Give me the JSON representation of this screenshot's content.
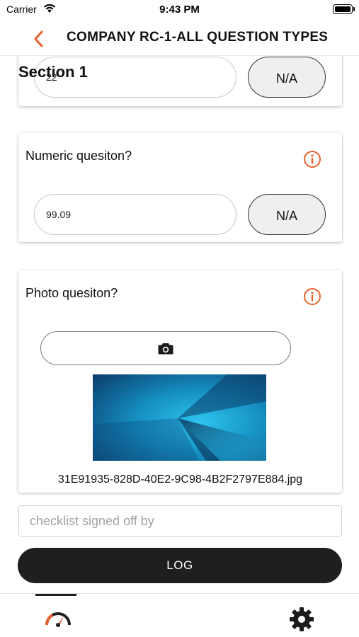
{
  "status_bar": {
    "carrier": "Carrier",
    "time": "9:43 PM"
  },
  "header": {
    "title": "COMPANY RC-1-ALL QUESTION TYPES"
  },
  "section": {
    "title": "Section 1"
  },
  "questions": [
    {
      "type": "text",
      "value": "22",
      "na_label": "N/A"
    },
    {
      "type": "numeric",
      "label": "Numeric quesiton?",
      "value": "99.09",
      "na_label": "N/A",
      "info_icon": "info-icon"
    },
    {
      "type": "photo",
      "label": "Photo quesiton?",
      "info_icon": "info-icon",
      "camera_icon": "camera-icon",
      "filename": "31E91935-828D-40E2-9C98-4B2F2797E884.jpg"
    }
  ],
  "signoff": {
    "placeholder": "checklist signed off by",
    "value": ""
  },
  "log_button": {
    "label": "LOG"
  },
  "tab_bar": {
    "tabs": [
      {
        "icon": "dashboard-gauge-icon",
        "active": true
      },
      {
        "icon": "gear-icon",
        "active": false
      }
    ]
  },
  "colors": {
    "accent": "#e8622c",
    "dark_button": "#1f1f1f",
    "photo_blue": "#1aa6d6"
  }
}
